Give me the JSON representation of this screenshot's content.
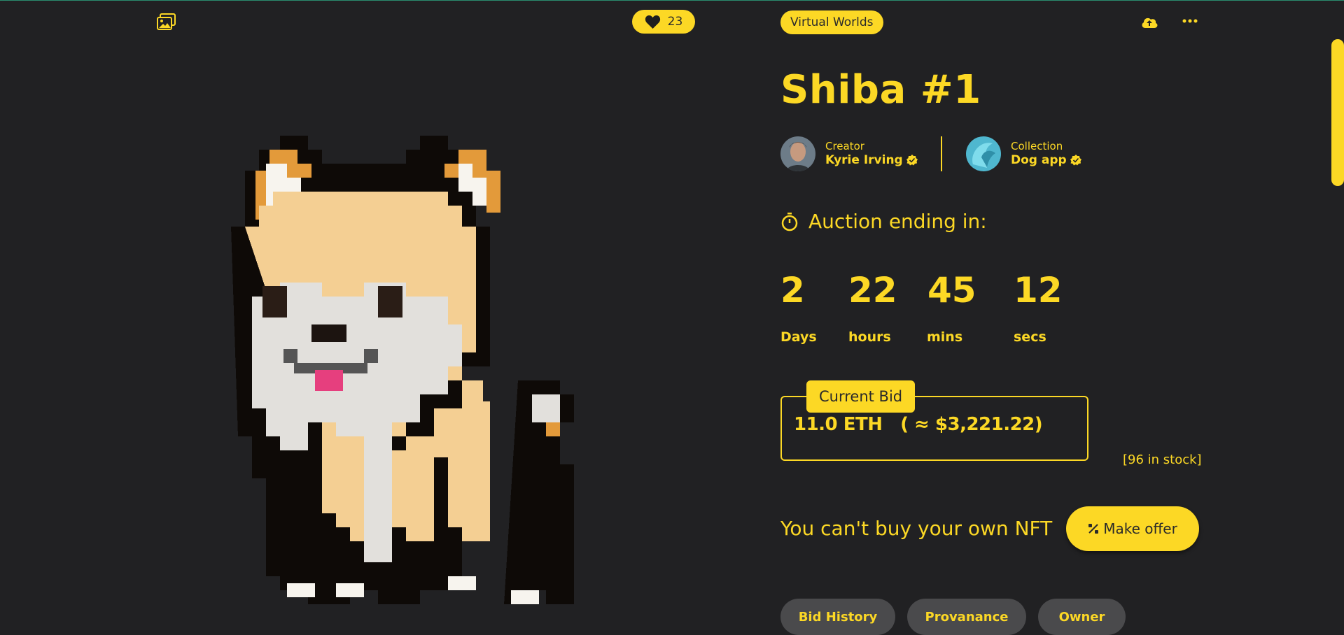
{
  "header": {
    "likes_count": "23",
    "category": "Virtual Worlds"
  },
  "nft": {
    "title": "Shiba #1",
    "creator": {
      "label": "Creator",
      "name": "Kyrie Irving"
    },
    "collection": {
      "label": "Collection",
      "name": "Dog app"
    }
  },
  "auction": {
    "heading": "Auction ending in:",
    "countdown": [
      {
        "value": "2",
        "unit": "Days"
      },
      {
        "value": "22",
        "unit": "hours"
      },
      {
        "value": "45",
        "unit": "mins"
      },
      {
        "value": "12",
        "unit": "secs"
      }
    ]
  },
  "bid": {
    "label": "Current Bid",
    "value": "11.0 ETH   ( ≈ $3,221.22)",
    "stock": "[96 in stock]"
  },
  "purchase": {
    "message": "You can't buy your own NFT",
    "offer_label": "Make offer"
  },
  "tabs": [
    "Bid History",
    "Provanance",
    "Owner"
  ],
  "colors": {
    "background": "#212123",
    "accent": "#fcd825",
    "tab_bg": "#4a4a4c"
  },
  "icons": {
    "image": "image-icon",
    "like": "heart-icon",
    "upload": "cloud-upload-icon",
    "more": "more-dots-icon",
    "verified": "verified-badge-icon",
    "timer": "stopwatch-icon",
    "offer": "percent-icon"
  }
}
